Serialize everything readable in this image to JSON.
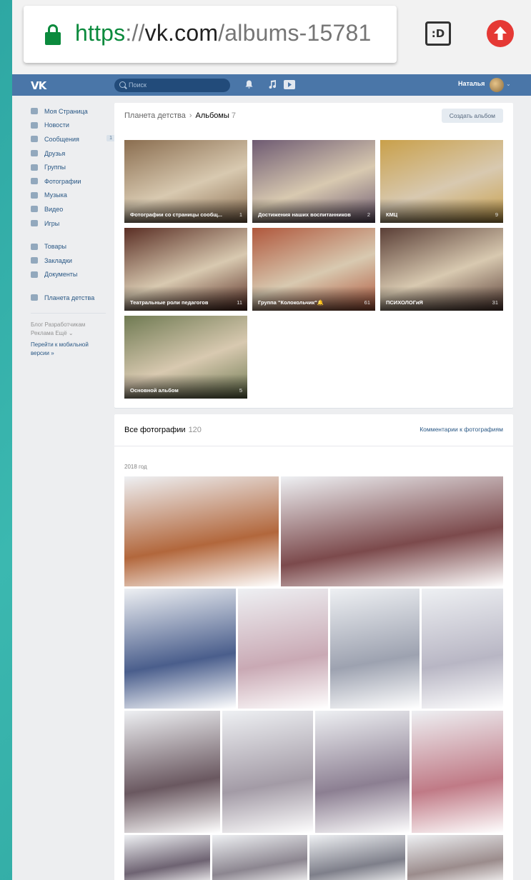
{
  "browser": {
    "url_scheme": "https",
    "url_sep": "://",
    "url_host": "vk.com",
    "url_path": "/albums-15781",
    "tab_switcher_label": ":D"
  },
  "header": {
    "logo": "VK",
    "search_placeholder": "Поиск",
    "user_name": "Наталья",
    "caret": "⌄",
    "bell_icon": "bell-icon",
    "music_icon": "music-icon",
    "play_icon": "play-icon"
  },
  "sidebar": {
    "items": [
      {
        "label": "Моя Страница"
      },
      {
        "label": "Новости"
      },
      {
        "label": "Сообщения",
        "badge": "1"
      },
      {
        "label": "Друзья"
      },
      {
        "label": "Группы"
      },
      {
        "label": "Фотографии"
      },
      {
        "label": "Музыка"
      },
      {
        "label": "Видео"
      },
      {
        "label": "Игры"
      },
      {
        "label": "Товары"
      },
      {
        "label": "Закладки"
      },
      {
        "label": "Документы"
      },
      {
        "label": "Планета детства"
      }
    ],
    "footer_line1": "Блог   Разработчикам",
    "footer_line2": "Реклама   Ещё ⌄",
    "mobile_line1": "Перейти к мобильной",
    "mobile_line2": "версии »"
  },
  "albums_panel": {
    "breadcrumb_group": "Планета детства",
    "breadcrumb_sep": "›",
    "breadcrumb_current": "Альбомы",
    "album_count": "7",
    "create_button": "Создать альбом",
    "albums": [
      {
        "title": "Фотографии со страницы сообщ...",
        "count": "1",
        "color": "#8a6d4f"
      },
      {
        "title": "Достижения наших воспитанников",
        "count": "2",
        "color": "#6e5a72"
      },
      {
        "title": "КМЦ",
        "count": "9",
        "color": "#c9a04a"
      },
      {
        "title": "Театральные роли педагогов",
        "count": "11",
        "color": "#5a2e24"
      },
      {
        "title": "Группа \"Колокольчик\"🔔",
        "count": "61",
        "color": "#b0573c"
      },
      {
        "title": "ПСИХОЛОГиЯ",
        "count": "31",
        "color": "#5a3e36"
      },
      {
        "title": "Основной альбом",
        "count": "5",
        "color": "#6f7a52"
      }
    ]
  },
  "photos_panel": {
    "title": "Все фотографии",
    "count": "120",
    "comments_link": "Комментарии к фотографиям",
    "year_label": "2018 год",
    "photo_colors": [
      "#b2673c",
      "#7c4a4c",
      "#4a5e8c",
      "#c9a9b4",
      "#9da2b0",
      "#b8b6c4",
      "#6a5860",
      "#a39ba6",
      "#8c7f92",
      "#c07a86",
      "#6e6372",
      "#8c8690",
      "#7e7f8a",
      "#9b8c8c"
    ]
  }
}
